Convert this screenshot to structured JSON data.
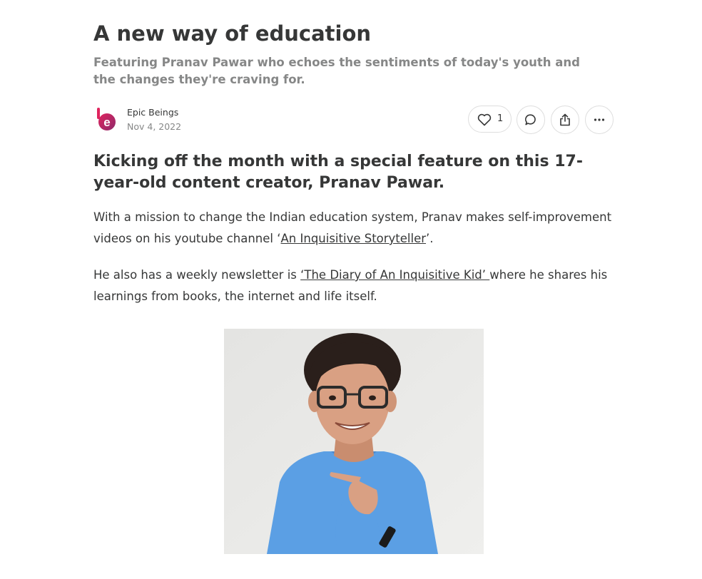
{
  "post": {
    "title": "A new way of education",
    "subtitle": "Featuring Pranav Pawar who echoes the sentiments of today's youth and the changes they're craving for."
  },
  "author": {
    "name": "Epic Beings",
    "date": "Nov 4, 2022",
    "avatar_letter": "e"
  },
  "actions": {
    "like_count": "1",
    "like_icon": "heart-icon",
    "comment_icon": "comment-bubble-icon",
    "share_icon": "share-icon",
    "more_icon": "more-dots-icon"
  },
  "body": {
    "heading": "Kicking off the month with a special feature on this 17-year-old content creator, Pranav Pawar.",
    "para1_before": "With a mission to change the Indian education system, Pranav makes self-improvement videos on his youtube channel ‘",
    "para1_link": "An Inquisitive Storyteller",
    "para1_after": "’.",
    "para2_before": "He also has a weekly newsletter is ",
    "para2_link": "‘The Diary of An Inquisitive Kid’ ",
    "para2_after": " where he shares his learnings from books, the internet and life itself."
  },
  "colors": {
    "brand": "#e0245e",
    "avatar_gradient_end": "#8e2a6b",
    "text": "#363737",
    "muted": "#868787",
    "border": "#dedede",
    "shirt": "#5b9fe4"
  }
}
